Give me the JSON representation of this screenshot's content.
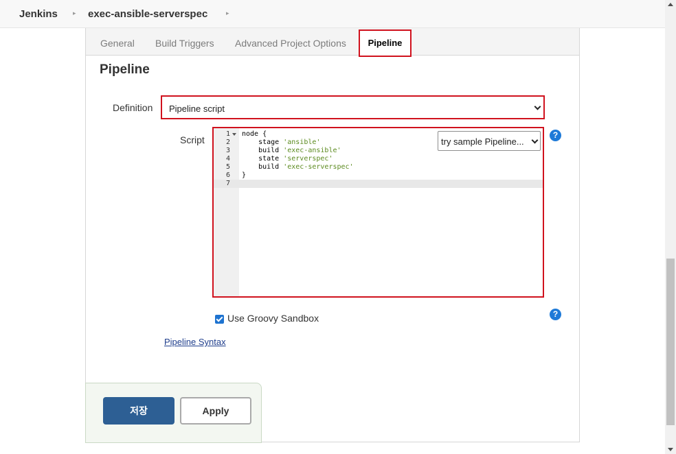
{
  "breadcrumb": {
    "items": [
      "Jenkins",
      "exec-ansible-serverspec"
    ]
  },
  "tabs": {
    "items": [
      "General",
      "Build Triggers",
      "Advanced Project Options"
    ],
    "active": "Pipeline"
  },
  "section": {
    "title": "Pipeline"
  },
  "definition": {
    "label": "Definition",
    "value": "Pipeline script"
  },
  "script": {
    "label": "Script",
    "sample_select": "try sample Pipeline...",
    "line_numbers": [
      "1",
      "2",
      "3",
      "4",
      "5",
      "6",
      "7"
    ],
    "lines": [
      {
        "code": "node {",
        "str": ""
      },
      {
        "code": "    stage ",
        "str": "'ansible'"
      },
      {
        "code": "    build ",
        "str": "'exec-ansible'"
      },
      {
        "code": "    state ",
        "str": "'serverspec'"
      },
      {
        "code": "    build ",
        "str": "'exec-serverspec'"
      },
      {
        "code": "}",
        "str": ""
      },
      {
        "code": "",
        "str": ""
      }
    ]
  },
  "sandbox": {
    "label": "Use Groovy Sandbox",
    "checked": true
  },
  "help_glyph": "?",
  "syntax_link": "Pipeline Syntax",
  "buttons": {
    "save": "저장",
    "apply": "Apply"
  },
  "colors": {
    "highlight": "#d0111d",
    "save_button": "#2d5f94",
    "help_icon": "#1e7ad8",
    "string": "#5b8a1e"
  }
}
